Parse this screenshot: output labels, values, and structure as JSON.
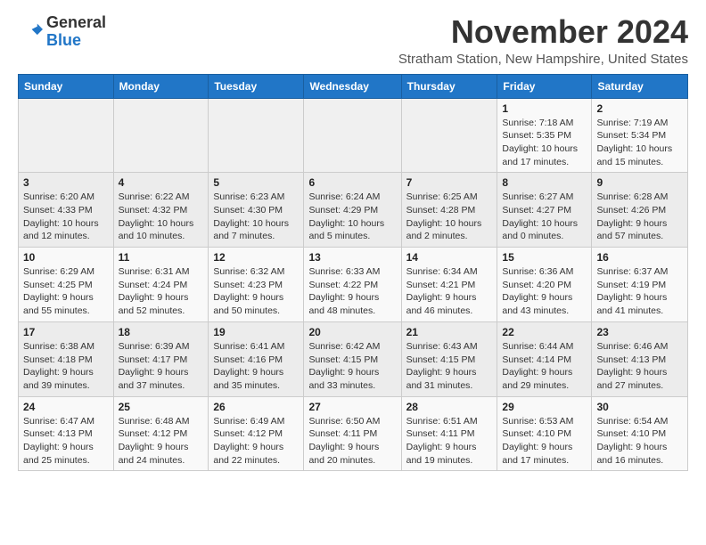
{
  "logo": {
    "general": "General",
    "blue": "Blue"
  },
  "header": {
    "month": "November 2024",
    "location": "Stratham Station, New Hampshire, United States"
  },
  "weekdays": [
    "Sunday",
    "Monday",
    "Tuesday",
    "Wednesday",
    "Thursday",
    "Friday",
    "Saturday"
  ],
  "weeks": [
    [
      {
        "day": "",
        "info": ""
      },
      {
        "day": "",
        "info": ""
      },
      {
        "day": "",
        "info": ""
      },
      {
        "day": "",
        "info": ""
      },
      {
        "day": "",
        "info": ""
      },
      {
        "day": "1",
        "info": "Sunrise: 7:18 AM\nSunset: 5:35 PM\nDaylight: 10 hours and 17 minutes."
      },
      {
        "day": "2",
        "info": "Sunrise: 7:19 AM\nSunset: 5:34 PM\nDaylight: 10 hours and 15 minutes."
      }
    ],
    [
      {
        "day": "3",
        "info": "Sunrise: 6:20 AM\nSunset: 4:33 PM\nDaylight: 10 hours and 12 minutes."
      },
      {
        "day": "4",
        "info": "Sunrise: 6:22 AM\nSunset: 4:32 PM\nDaylight: 10 hours and 10 minutes."
      },
      {
        "day": "5",
        "info": "Sunrise: 6:23 AM\nSunset: 4:30 PM\nDaylight: 10 hours and 7 minutes."
      },
      {
        "day": "6",
        "info": "Sunrise: 6:24 AM\nSunset: 4:29 PM\nDaylight: 10 hours and 5 minutes."
      },
      {
        "day": "7",
        "info": "Sunrise: 6:25 AM\nSunset: 4:28 PM\nDaylight: 10 hours and 2 minutes."
      },
      {
        "day": "8",
        "info": "Sunrise: 6:27 AM\nSunset: 4:27 PM\nDaylight: 10 hours and 0 minutes."
      },
      {
        "day": "9",
        "info": "Sunrise: 6:28 AM\nSunset: 4:26 PM\nDaylight: 9 hours and 57 minutes."
      }
    ],
    [
      {
        "day": "10",
        "info": "Sunrise: 6:29 AM\nSunset: 4:25 PM\nDaylight: 9 hours and 55 minutes."
      },
      {
        "day": "11",
        "info": "Sunrise: 6:31 AM\nSunset: 4:24 PM\nDaylight: 9 hours and 52 minutes."
      },
      {
        "day": "12",
        "info": "Sunrise: 6:32 AM\nSunset: 4:23 PM\nDaylight: 9 hours and 50 minutes."
      },
      {
        "day": "13",
        "info": "Sunrise: 6:33 AM\nSunset: 4:22 PM\nDaylight: 9 hours and 48 minutes."
      },
      {
        "day": "14",
        "info": "Sunrise: 6:34 AM\nSunset: 4:21 PM\nDaylight: 9 hours and 46 minutes."
      },
      {
        "day": "15",
        "info": "Sunrise: 6:36 AM\nSunset: 4:20 PM\nDaylight: 9 hours and 43 minutes."
      },
      {
        "day": "16",
        "info": "Sunrise: 6:37 AM\nSunset: 4:19 PM\nDaylight: 9 hours and 41 minutes."
      }
    ],
    [
      {
        "day": "17",
        "info": "Sunrise: 6:38 AM\nSunset: 4:18 PM\nDaylight: 9 hours and 39 minutes."
      },
      {
        "day": "18",
        "info": "Sunrise: 6:39 AM\nSunset: 4:17 PM\nDaylight: 9 hours and 37 minutes."
      },
      {
        "day": "19",
        "info": "Sunrise: 6:41 AM\nSunset: 4:16 PM\nDaylight: 9 hours and 35 minutes."
      },
      {
        "day": "20",
        "info": "Sunrise: 6:42 AM\nSunset: 4:15 PM\nDaylight: 9 hours and 33 minutes."
      },
      {
        "day": "21",
        "info": "Sunrise: 6:43 AM\nSunset: 4:15 PM\nDaylight: 9 hours and 31 minutes."
      },
      {
        "day": "22",
        "info": "Sunrise: 6:44 AM\nSunset: 4:14 PM\nDaylight: 9 hours and 29 minutes."
      },
      {
        "day": "23",
        "info": "Sunrise: 6:46 AM\nSunset: 4:13 PM\nDaylight: 9 hours and 27 minutes."
      }
    ],
    [
      {
        "day": "24",
        "info": "Sunrise: 6:47 AM\nSunset: 4:13 PM\nDaylight: 9 hours and 25 minutes."
      },
      {
        "day": "25",
        "info": "Sunrise: 6:48 AM\nSunset: 4:12 PM\nDaylight: 9 hours and 24 minutes."
      },
      {
        "day": "26",
        "info": "Sunrise: 6:49 AM\nSunset: 4:12 PM\nDaylight: 9 hours and 22 minutes."
      },
      {
        "day": "27",
        "info": "Sunrise: 6:50 AM\nSunset: 4:11 PM\nDaylight: 9 hours and 20 minutes."
      },
      {
        "day": "28",
        "info": "Sunrise: 6:51 AM\nSunset: 4:11 PM\nDaylight: 9 hours and 19 minutes."
      },
      {
        "day": "29",
        "info": "Sunrise: 6:53 AM\nSunset: 4:10 PM\nDaylight: 9 hours and 17 minutes."
      },
      {
        "day": "30",
        "info": "Sunrise: 6:54 AM\nSunset: 4:10 PM\nDaylight: 9 hours and 16 minutes."
      }
    ]
  ]
}
